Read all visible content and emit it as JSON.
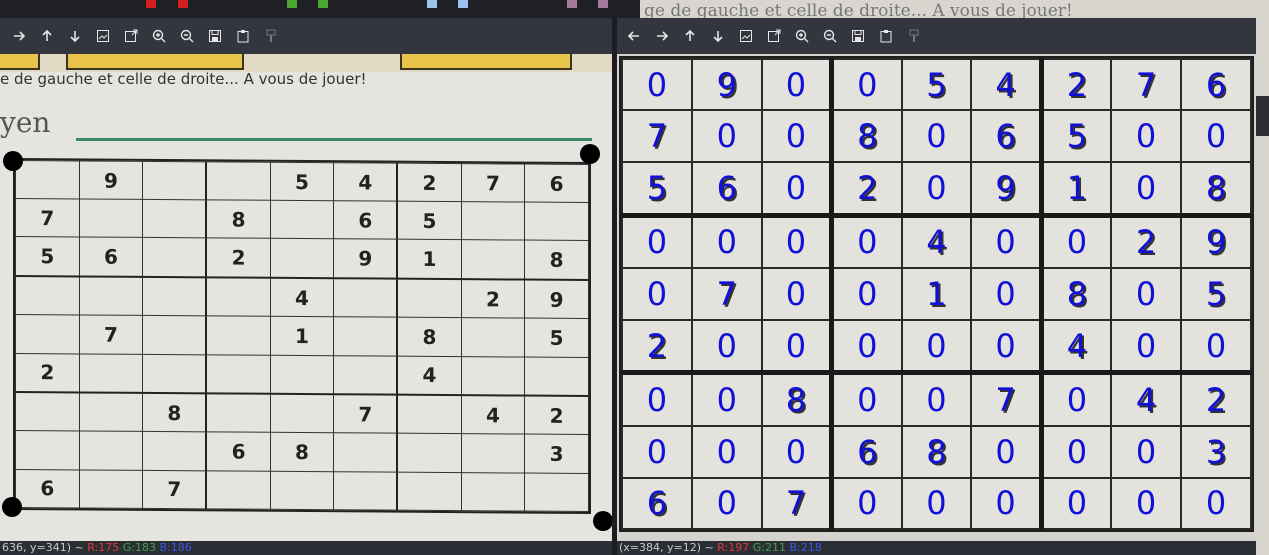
{
  "top_swatches": [
    "#d21f1f",
    "#d21f1f",
    "#4aa832",
    "#4aa832",
    "#9cc3f0",
    "#9cc3f0",
    "#a57b9c",
    "#a57b9c"
  ],
  "background_text": "ge de gauche et celle de droite... A vous de jouer!",
  "left_window": {
    "toolbar_icons": [
      "arrow-right-icon",
      "arrow-up-icon",
      "arrow-down-icon",
      "image-icon",
      "image-export-icon",
      "zoom-in-icon",
      "zoom-out-icon",
      "save-icon",
      "clipboard-icon",
      "brush-icon"
    ],
    "caption": "e de gauche et celle de droite... A vous de jouer!",
    "heading": "yen",
    "grid": [
      [
        "",
        "9",
        "",
        "",
        "5",
        "4",
        "2",
        "7",
        "6"
      ],
      [
        "7",
        "",
        "",
        "8",
        "",
        "6",
        "5",
        "",
        ""
      ],
      [
        "5",
        "6",
        "",
        "2",
        "",
        "9",
        "1",
        "",
        "8"
      ],
      [
        "",
        "",
        "",
        "",
        "4",
        "",
        "",
        "2",
        "9"
      ],
      [
        "",
        "7",
        "",
        "",
        "1",
        "",
        "8",
        "",
        "5"
      ],
      [
        "2",
        "",
        "",
        "",
        "",
        "",
        "4",
        "",
        ""
      ],
      [
        "",
        "",
        "8",
        "",
        "",
        "7",
        "",
        "4",
        "2"
      ],
      [
        "",
        "",
        "",
        "6",
        "8",
        "",
        "",
        "",
        "3"
      ],
      [
        "6",
        "",
        "7",
        "",
        "",
        "",
        "",
        "",
        ""
      ]
    ],
    "status": {
      "coords": "636, y=341) ~ ",
      "r": "R:175",
      "g": "G:183",
      "b": "B:186"
    }
  },
  "right_window": {
    "toolbar_icons": [
      "arrow-left-icon",
      "arrow-right-icon",
      "arrow-up-icon",
      "arrow-down-icon",
      "image-icon",
      "image-export-icon",
      "zoom-in-icon",
      "zoom-out-icon",
      "save-icon",
      "clipboard-icon",
      "brush-icon"
    ],
    "grid": [
      [
        "0",
        "9",
        "0",
        "0",
        "5",
        "4",
        "2",
        "7",
        "6"
      ],
      [
        "7",
        "0",
        "0",
        "8",
        "0",
        "6",
        "5",
        "0",
        "0"
      ],
      [
        "5",
        "6",
        "0",
        "2",
        "0",
        "9",
        "1",
        "0",
        "8"
      ],
      [
        "0",
        "0",
        "0",
        "0",
        "4",
        "0",
        "0",
        "2",
        "9"
      ],
      [
        "0",
        "7",
        "0",
        "0",
        "1",
        "0",
        "8",
        "0",
        "5"
      ],
      [
        "2",
        "0",
        "0",
        "0",
        "0",
        "0",
        "4",
        "0",
        "0"
      ],
      [
        "0",
        "0",
        "8",
        "0",
        "0",
        "7",
        "0",
        "4",
        "2"
      ],
      [
        "0",
        "0",
        "0",
        "6",
        "8",
        "0",
        "0",
        "0",
        "3"
      ],
      [
        "6",
        "0",
        "7",
        "0",
        "0",
        "0",
        "0",
        "0",
        "0"
      ]
    ],
    "status": {
      "coords": "(x=384, y=12) ~ ",
      "r": "R:197",
      "g": "G:211",
      "b": "B:218"
    }
  }
}
